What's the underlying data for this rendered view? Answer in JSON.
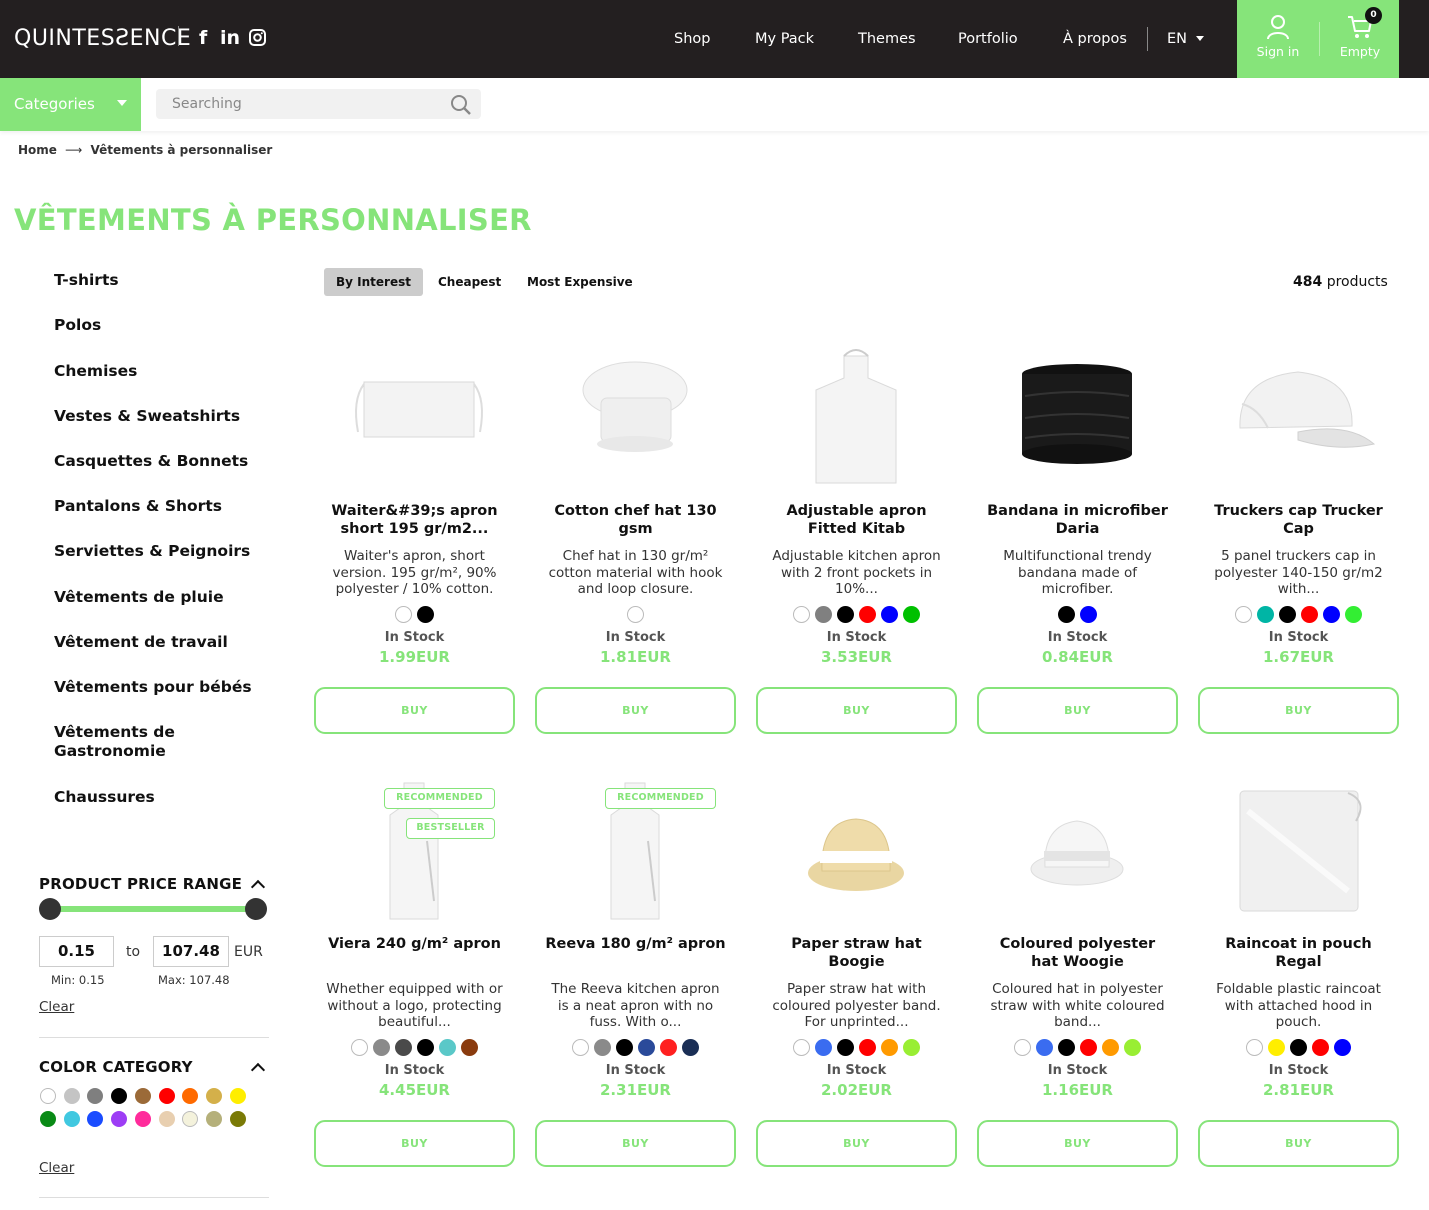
{
  "header": {
    "logo": "QUINTESƧENCE",
    "social": [
      "f",
      "in"
    ],
    "nav": [
      "Shop",
      "My Pack",
      "Themes",
      "Portfolio",
      "À propos"
    ],
    "lang": "EN",
    "sign_in": "Sign in",
    "cart_label": "Empty",
    "cart_count": "0",
    "accent": "#86e47a"
  },
  "subbar": {
    "categories_label": "Categories",
    "search_placeholder": "Searching"
  },
  "breadcrumb": {
    "home": "Home",
    "arrow": "⟶",
    "current": "Vêtements à personnaliser"
  },
  "page_title": "VÊTEMENTS À PERSONNALISER",
  "sidebar": {
    "categories": [
      "T-shirts",
      "Polos",
      "Chemises",
      "Vestes & Sweatshirts",
      "Casquettes & Bonnets",
      "Pantalons & Shorts",
      "Serviettes & Peignoirs",
      "Vêtements de pluie",
      "Vêtement de travail",
      "Vêtements pour bébés",
      "Vêtements de Gastronomie",
      "Chaussures"
    ],
    "price_heading": "PRODUCT PRICE RANGE",
    "min_value": "0.15",
    "max_value": "107.48",
    "to_label": "to",
    "currency": "EUR",
    "min_label": "Min: 0.15",
    "max_label": "Max: 107.48",
    "clear": "Clear",
    "color_heading": "COLOR CATEGORY",
    "color_swatches": [
      "#ffffff",
      "#c4c4c4",
      "#7f7f7f",
      "#000000",
      "#9b6a38",
      "#ff0000",
      "#ff6a00",
      "#d4b04a",
      "#ffee00",
      "#098a16",
      "#40c8e0",
      "#1a4cff",
      "#9d3df5",
      "#ff2b9b",
      "#e8cfb0",
      "#f4f2dc",
      "#b5b07a",
      "#7a7a06"
    ]
  },
  "sort": {
    "options": [
      "By Interest",
      "Cheapest",
      "Most Expensive"
    ],
    "active": "By Interest"
  },
  "product_count": {
    "number": "484",
    "label": "products"
  },
  "buy_label": "BUY",
  "stock_label": "In Stock",
  "products": [
    {
      "name": "Waiter&#39;s apron short 195 gr/m2...",
      "desc": "Waiter's apron, short version. 195 gr/m², 90% polyester / 10% cotton.",
      "price": "1.99EUR",
      "colors": [
        "#ffffff",
        "#000000"
      ],
      "image": "short-apron-icon",
      "tags": []
    },
    {
      "name": "Cotton chef hat 130 gsm",
      "desc": "Chef hat in 130 gr/m² cotton material with hook and loop closure.",
      "price": "1.81EUR",
      "colors": [
        "#ffffff"
      ],
      "image": "chef-hat-icon",
      "tags": []
    },
    {
      "name": "Adjustable apron Fitted Kitab",
      "desc": "Adjustable kitchen apron with 2 front pockets in 10%...",
      "price": "3.53EUR",
      "colors": [
        "#ffffff",
        "#808080",
        "#000000",
        "#ff0000",
        "#0000ff",
        "#00c000"
      ],
      "image": "apron-icon",
      "tags": []
    },
    {
      "name": "Bandana in microfiber Daria",
      "desc": "Multifunctional trendy bandana made of microfiber.",
      "price": "0.84EUR",
      "colors": [
        "#000000",
        "#0000ff"
      ],
      "image": "bandana-icon",
      "tags": []
    },
    {
      "name": "Truckers cap Trucker Cap",
      "desc": "5 panel truckers cap in polyester 140-150 gr/m2 with...",
      "price": "1.67EUR",
      "colors": [
        "#ffffff",
        "#00b5a5",
        "#000000",
        "#ff0000",
        "#0000ff",
        "#33ee33"
      ],
      "image": "cap-icon",
      "tags": []
    },
    {
      "name": "Viera 240 g/m² apron",
      "desc": "Whether equipped with or without a logo, protecting beautiful...",
      "price": "4.45EUR",
      "colors": [
        "#ffffff",
        "#8a8a8a",
        "#4a4a4a",
        "#000000",
        "#5ac8c8",
        "#8a3b0e"
      ],
      "image": "long-apron-icon",
      "tags": [
        "RECOMMENDED",
        "BESTSELLER"
      ]
    },
    {
      "name": "Reeva 180 g/m² apron",
      "desc": "The Reeva kitchen apron is a neat apron with no fuss. With o...",
      "price": "2.31EUR",
      "colors": [
        "#ffffff",
        "#8a8a8a",
        "#000000",
        "#2a4a9a",
        "#ff2020",
        "#1a2e55"
      ],
      "image": "long-apron-icon",
      "tags": [
        "RECOMMENDED"
      ]
    },
    {
      "name": "Paper straw hat Boogie",
      "desc": "Paper straw hat with coloured polyester band. For unprinted...",
      "price": "2.02EUR",
      "colors": [
        "#ffffff",
        "#3a6cf0",
        "#000000",
        "#ff0000",
        "#ff9a00",
        "#99ee33"
      ],
      "image": "straw-hat-icon",
      "tags": []
    },
    {
      "name": "Coloured polyester hat Woogie",
      "desc": "Coloured hat in polyester straw with white coloured band...",
      "price": "1.16EUR",
      "colors": [
        "#ffffff",
        "#3a6cf0",
        "#000000",
        "#ff0000",
        "#ff9a00",
        "#99ee33"
      ],
      "image": "fedora-icon",
      "tags": []
    },
    {
      "name": "Raincoat in pouch Regal",
      "desc": "Foldable plastic raincoat with attached hood in pouch.",
      "price": "2.81EUR",
      "colors": [
        "#ffffff",
        "#ffee00",
        "#000000",
        "#ff0000",
        "#0000ff"
      ],
      "image": "raincoat-pouch-icon",
      "tags": []
    }
  ]
}
